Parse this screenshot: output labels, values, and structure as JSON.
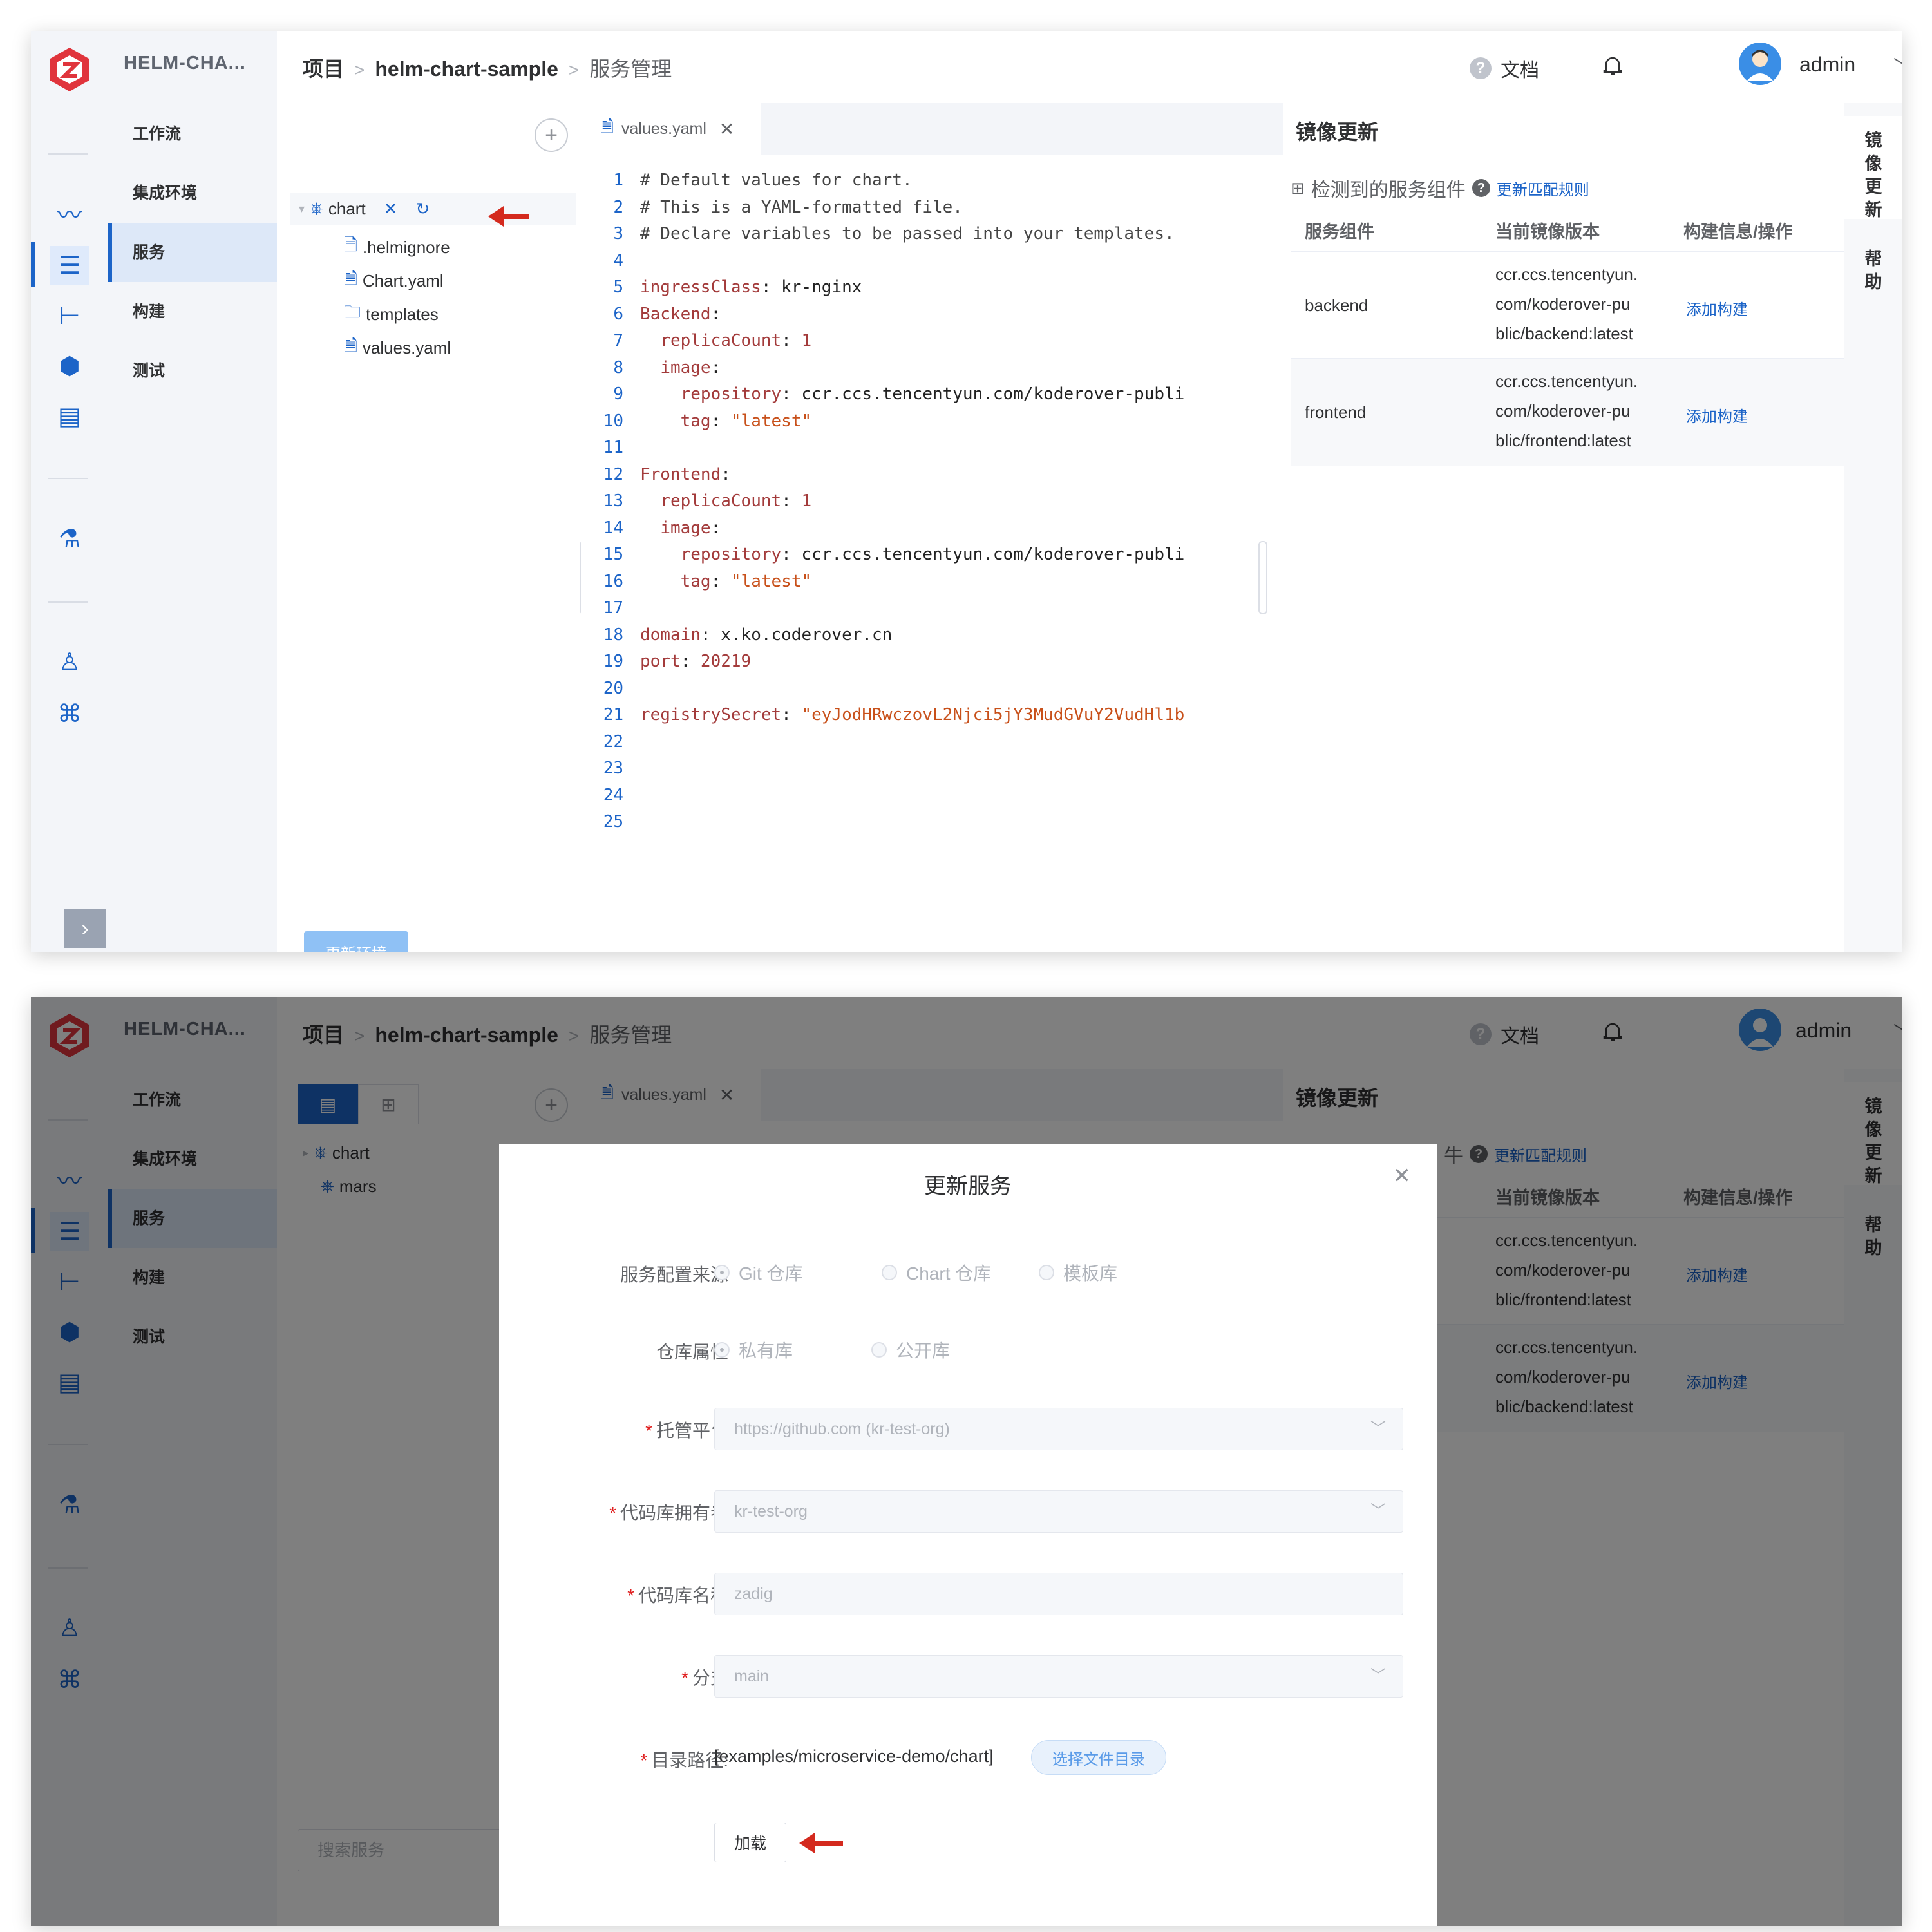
{
  "app_title": "HELM-CHA...",
  "nav_items": [
    {
      "label": "工作流"
    },
    {
      "label": "集成环境"
    },
    {
      "label": "服务"
    },
    {
      "label": "构建"
    },
    {
      "label": "测试"
    }
  ],
  "breadcrumb": {
    "project": "项目",
    "sep": ">",
    "name": "helm-chart-sample",
    "current": "服务管理"
  },
  "header": {
    "docs_label": "文档",
    "user": "admin"
  },
  "tree": {
    "root": "chart",
    "files": [
      ".helmignore",
      "Chart.yaml",
      "templates",
      "values.yaml"
    ],
    "shot2_items": [
      "chart",
      "mars"
    ]
  },
  "editor": {
    "tab_label": "values.yaml",
    "lines": [
      "# Default values for chart.",
      "# This is a YAML-formatted file.",
      "# Declare variables to be passed into your templates.",
      "",
      "ingressClass: kr-nginx",
      "Backend:",
      "  replicaCount: 1",
      "  image:",
      "    repository: ccr.ccs.tencentyun.com/koderover-publi",
      "    tag: \"latest\"",
      "",
      "Frontend:",
      "  replicaCount: 1",
      "  image:",
      "    repository: ccr.ccs.tencentyun.com/koderover-publi",
      "    tag: \"latest\"",
      "",
      "domain: x.ko.coderover.cn",
      "port: 20219",
      "",
      "registrySecret: \"eyJodHRwczovL2Njci5jY3MudGVuY2VudHl1b",
      "",
      "",
      "",
      ""
    ]
  },
  "image_update": {
    "title": "镜像更新",
    "detected_label": "检测到的服务组件",
    "rules_link": "更新匹配规则",
    "col_component": "服务组件",
    "col_image": "当前镜像版本",
    "col_actions": "构建信息/操作",
    "rows": [
      {
        "component": "backend",
        "image_l1": "ccr.ccs.tencentyun.",
        "image_l2": "com/koderover-pu",
        "image_l3": "blic/backend:latest",
        "action": "添加构建"
      },
      {
        "component": "frontend",
        "image_l1": "ccr.ccs.tencentyun.",
        "image_l2": "com/koderover-pu",
        "image_l3": "blic/frontend:latest",
        "action": "添加构建"
      }
    ],
    "rows_shot2": [
      {
        "image_l1": "ccr.ccs.tencentyun.",
        "image_l2": "com/koderover-pu",
        "image_l3": "blic/frontend:latest",
        "action": "添加构建"
      },
      {
        "image_l1": "ccr.ccs.tencentyun.",
        "image_l2": "com/koderover-pu",
        "image_l3": "blic/backend:latest",
        "action": "添加构建"
      }
    ],
    "partial_label": "牛"
  },
  "vtabs": [
    "镜像更新",
    "帮助"
  ],
  "update_env_button": "更新环境",
  "search_placeholder": "搜索服务",
  "dialog": {
    "title": "更新服务",
    "source_label": "服务配置来源",
    "source_options": [
      "Git 仓库",
      "Chart 仓库",
      "模板库"
    ],
    "repo_type_label": "仓库属性",
    "repo_type_options": [
      "私有库",
      "公开库"
    ],
    "platform_label": "托管平台",
    "platform_value": "https://github.com (kr-test-org)",
    "owner_label": "代码库拥有者",
    "owner_value": "kr-test-org",
    "repo_label": "代码库名称",
    "repo_value": "zadig",
    "branch_label": "分支",
    "branch_value": "main",
    "path_label": "目录路径:",
    "path_value": "[examples/microservice-demo/chart]",
    "choose_dir_button": "选择文件目录",
    "load_button": "加载"
  },
  "colors": {
    "accent": "#1c64c8",
    "arrow": "#d42a1e"
  }
}
